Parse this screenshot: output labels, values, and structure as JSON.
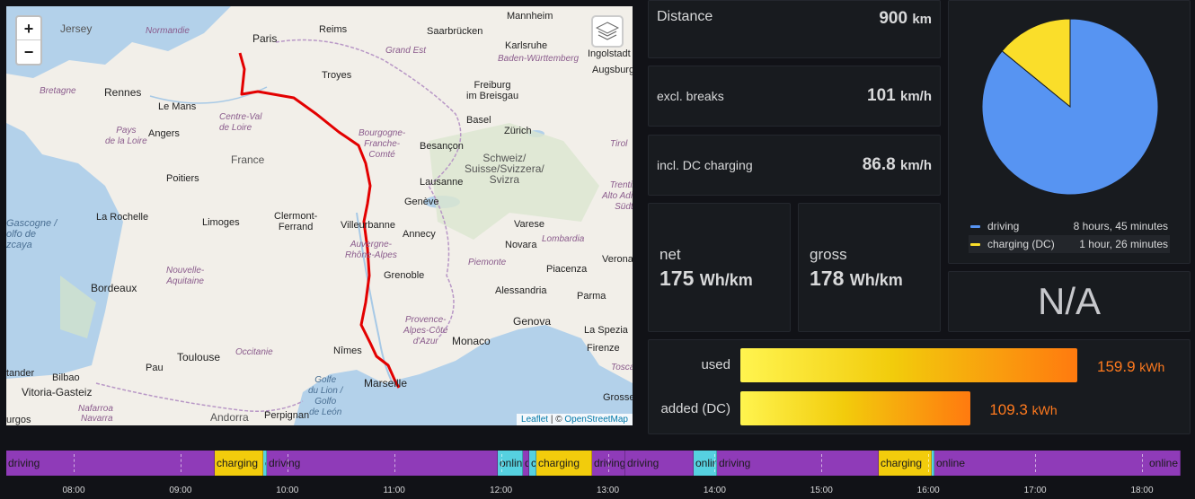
{
  "map": {
    "zoom_in": "+",
    "zoom_out": "−",
    "attribution_leaflet": "Leaflet",
    "attribution_sep": " | © ",
    "attribution_osm": "OpenStreetMap",
    "labels": {
      "jersey": "Jersey",
      "normandie": "Normandie",
      "paris": "Paris",
      "reims": "Reims",
      "saarbrucken": "Saarbrücken",
      "mannheim": "Mannheim",
      "karlsruhe": "Karlsruhe",
      "grand_est": "Grand Est",
      "baden": "Baden-Württemberg",
      "ingolstadt": "Ingolstadt",
      "augsburg": "Augsburg",
      "bretagne": "Bretagne",
      "rennes": "Rennes",
      "le_mans": "Le Mans",
      "troyes": "Troyes",
      "freiburg": "Freiburg\nim Breisgau",
      "centre": "Centre-Val\nde Loire",
      "angers": "Angers",
      "pays_loire": "Pays\nde la Loire",
      "bourgogne": "Bourgogne-\nFranche-\nComté",
      "basel": "Basel",
      "zurich": "Zürich",
      "besancon": "Besançon",
      "france": "France",
      "schweiz": "Schweiz/\nSuisse/Svizzera/\nSvizra",
      "tirol": "Tirol",
      "poitiers": "Poitiers",
      "lausanne": "Lausanne",
      "alto_adige": "Trentino-\nAlto Adige/\nSüdtirol",
      "geneve": "Genève",
      "gascogne": "Gascogne /\nolfo de\nzcaya",
      "la_rochelle": "La Rochelle",
      "limoges": "Limoges",
      "clermont": "Clermont-\nFerrand",
      "villeurbanne": "Villeurbanne",
      "annecy": "Annecy",
      "varese": "Varese",
      "auvergne": "Auvergne-\nRhône-Alpes",
      "lombardia": "Lombardia",
      "novara": "Novara",
      "verona": "Verona",
      "nouvelle": "Nouvelle-\nAquitaine",
      "piemonte": "Piemonte",
      "piacenza": "Piacenza",
      "grenoble": "Grenoble",
      "bordeaux": "Bordeaux",
      "alessandria": "Alessandria",
      "parma": "Parma",
      "genova": "Genova",
      "provence": "Provence-\nAlpes-Côte\nd'Azur",
      "la_spezia": "La Spezia",
      "toulouse": "Toulouse",
      "occitanie": "Occitanie",
      "nimes": "Nîmes",
      "monaco": "Monaco",
      "firenze": "Firenze",
      "pau": "Pau",
      "tander": "tander",
      "bilbao": "Bilbao",
      "marseille": "Marseille",
      "golfe": "Golfe\ndu Lion /\nGolfo\nde León",
      "toscana": "Toscana",
      "vitoria": "Vitoria-Gasteiz",
      "navarra": "Nafarroa",
      "navarra2": "Navarra",
      "andorra": "Andorra",
      "perpignan": "Perpignan",
      "grosse": "Grosse",
      "burgos": "urgos"
    }
  },
  "stats": {
    "distance": {
      "label": "Distance",
      "value": "900",
      "unit": "km"
    },
    "excl": {
      "label": "excl. breaks",
      "value": "101",
      "unit": "km/h"
    },
    "incl": {
      "label": "incl. DC charging",
      "value": "86.8",
      "unit": "km/h"
    },
    "net": {
      "label": "net",
      "value": "175",
      "unit": "Wh/km"
    },
    "gross": {
      "label": "gross",
      "value": "178",
      "unit": "Wh/km"
    },
    "na": "N/A"
  },
  "pie": {
    "legend": [
      {
        "name": "driving",
        "value": "8 hours, 45 minutes",
        "color": "#5794f2"
      },
      {
        "name": "charging (DC)",
        "value": "1 hour, 26 minutes",
        "color": "#fade2a"
      }
    ]
  },
  "chart_data": [
    {
      "type": "pie",
      "categories": [
        "driving",
        "charging (DC)"
      ],
      "values": [
        525,
        86
      ],
      "value_unit": "minutes"
    },
    {
      "type": "bar",
      "categories": [
        "used",
        "added (DC)"
      ],
      "values": [
        159.9,
        109.3
      ],
      "unit": "kWh"
    }
  ],
  "energy": {
    "used": {
      "label": "used",
      "value": "159.9",
      "unit": "kWh"
    },
    "added": {
      "label": "added (DC)",
      "value": "109.3",
      "unit": "kWh"
    }
  },
  "timeline": {
    "states": [
      {
        "label": "driving",
        "color": "#8f3bb8"
      },
      {
        "label": "charging",
        "color": "#f2cc0c"
      },
      {
        "label": "online",
        "color": "#56d1e0"
      }
    ],
    "segment_labels": [
      "driving",
      "charging",
      "c",
      "driving",
      "online",
      "d",
      "c",
      "charging",
      "driving",
      "driving",
      "online",
      "driving",
      "charging",
      "",
      "online"
    ],
    "ticks": [
      "08:00",
      "09:00",
      "10:00",
      "11:00",
      "12:00",
      "13:00",
      "14:00",
      "15:00",
      "16:00",
      "17:00",
      "18:00"
    ]
  }
}
